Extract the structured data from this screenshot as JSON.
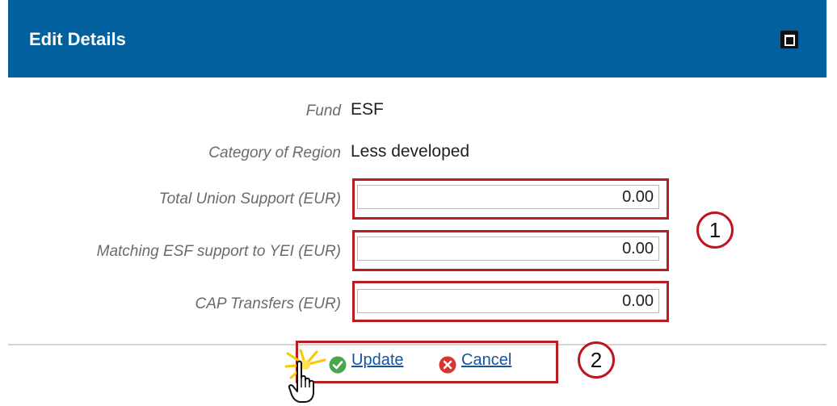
{
  "dialog": {
    "title": "Edit Details",
    "maximize_icon": "maximize-icon"
  },
  "form": {
    "fund": {
      "label": "Fund",
      "value": "ESF"
    },
    "category": {
      "label": "Category of Region",
      "value": "Less developed"
    },
    "total_union_support": {
      "label": "Total Union Support (EUR)",
      "value": "0.00"
    },
    "matching_esf": {
      "label": "Matching ESF support to YEI (EUR)",
      "value": "0.00"
    },
    "cap_transfers": {
      "label": "CAP Transfers (EUR)",
      "value": "0.00"
    }
  },
  "actions": {
    "update_label": "Update",
    "update_icon": "check-circle-icon",
    "cancel_label": "Cancel",
    "cancel_icon": "x-circle-icon"
  },
  "callouts": [
    "1",
    "2"
  ],
  "colors": {
    "header": "#03609e",
    "highlight": "#b81d24",
    "link": "#1354a5",
    "update_icon": "#4aa64a",
    "cancel_icon": "#d9342e"
  }
}
